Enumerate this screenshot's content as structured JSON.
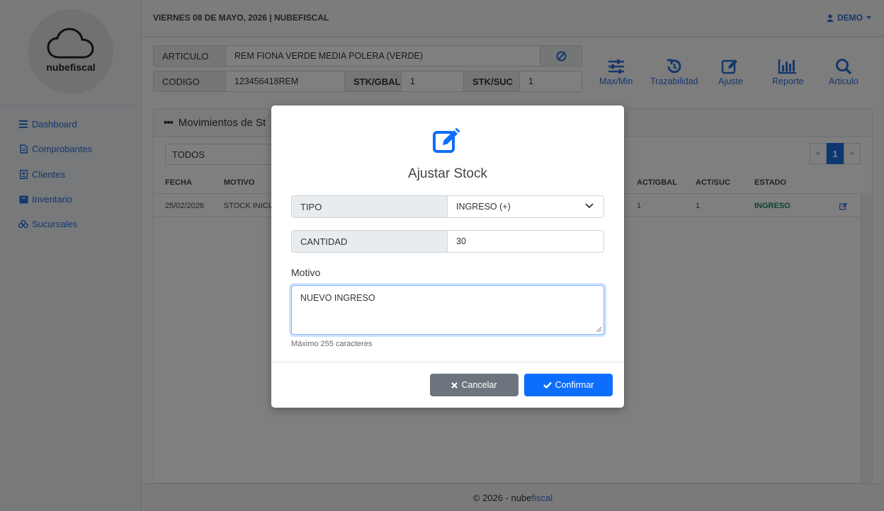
{
  "sidebar": {
    "brand": "nubefiscal",
    "items": [
      {
        "label": "Dashboard",
        "icon": "bars-icon"
      },
      {
        "label": "Comprobantes",
        "icon": "file-icon"
      },
      {
        "label": "Clientes",
        "icon": "contact-card-icon"
      },
      {
        "label": "Inventario",
        "icon": "box-icon"
      },
      {
        "label": "Sucursales",
        "icon": "cubes-icon"
      }
    ]
  },
  "topbar": {
    "date": "VIERNES 08 DE MAYO, 2026 | NUBEFISCAL",
    "user": "DEMO"
  },
  "article": {
    "articulo_label": "ARTICULO",
    "articulo_value": "REM FIONA VERDE MEDIA POLERA (VERDE)",
    "codigo_label": "CODIGO",
    "codigo_value": "123456418REM",
    "stk_gbal_label": "STK/GBAL",
    "stk_gbal_value": "1",
    "stk_suc_label": "STK/SUC",
    "stk_suc_value": "1"
  },
  "toolbar": {
    "maxmin": "Max/Min",
    "trazabilidad": "Trazabilidad",
    "ajuste": "Ajuste",
    "reporte": "Reporte",
    "articulo": "Articulo"
  },
  "movimientos": {
    "title": "Movimientos de St",
    "filter": "TODOS",
    "pager": {
      "prev": "«",
      "page": "1",
      "next": "»"
    },
    "headers": {
      "fecha": "FECHA",
      "motivo": "MOTIVO",
      "act_gbal": "ACT/GBAL",
      "act_suc": "ACT/SUC",
      "estado": "ESTADO"
    },
    "rows": [
      {
        "fecha": "25/02/2026",
        "motivo": "STOCK INICIA",
        "act_gbal": "1",
        "act_suc": "1",
        "estado": "INGRESO"
      }
    ]
  },
  "footer": {
    "copy": "© 2026 - nube",
    "brand2": "fiscal"
  },
  "modal": {
    "title": "Ajustar Stock",
    "tipo_label": "TIPO",
    "tipo_value": "INGRESO (+)",
    "cantidad_label": "CANTIDAD",
    "cantidad_value": "30",
    "motivo_label": "Motivo",
    "motivo_value": "NUEVO INGRESO",
    "hint": "Máximo 255 caracteres",
    "cancel": "Cancelar",
    "confirm": "Confirmar"
  },
  "colors": {
    "accent": "#0d6efd",
    "link": "#2b6fd6",
    "success": "#198754",
    "secondary": "#6c757d"
  }
}
